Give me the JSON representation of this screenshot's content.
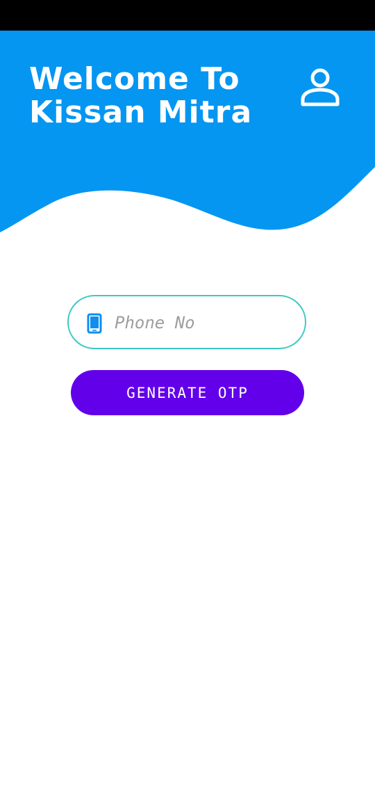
{
  "header": {
    "title": "Welcome To Kissan Mitra",
    "profile_icon": "person-outline-icon"
  },
  "login": {
    "phone_placeholder": "Phone No",
    "phone_value": "",
    "phone_icon": "smartphone-icon",
    "generate_label": "GENERATE OTP"
  },
  "colors": {
    "status_bar": "#000000",
    "header_blue": "#0596f2",
    "field_border": "#3cc9c2",
    "button_purple": "#6200ea",
    "icon_blue": "#0d8ef0",
    "placeholder_gray": "#9e9e9e"
  }
}
